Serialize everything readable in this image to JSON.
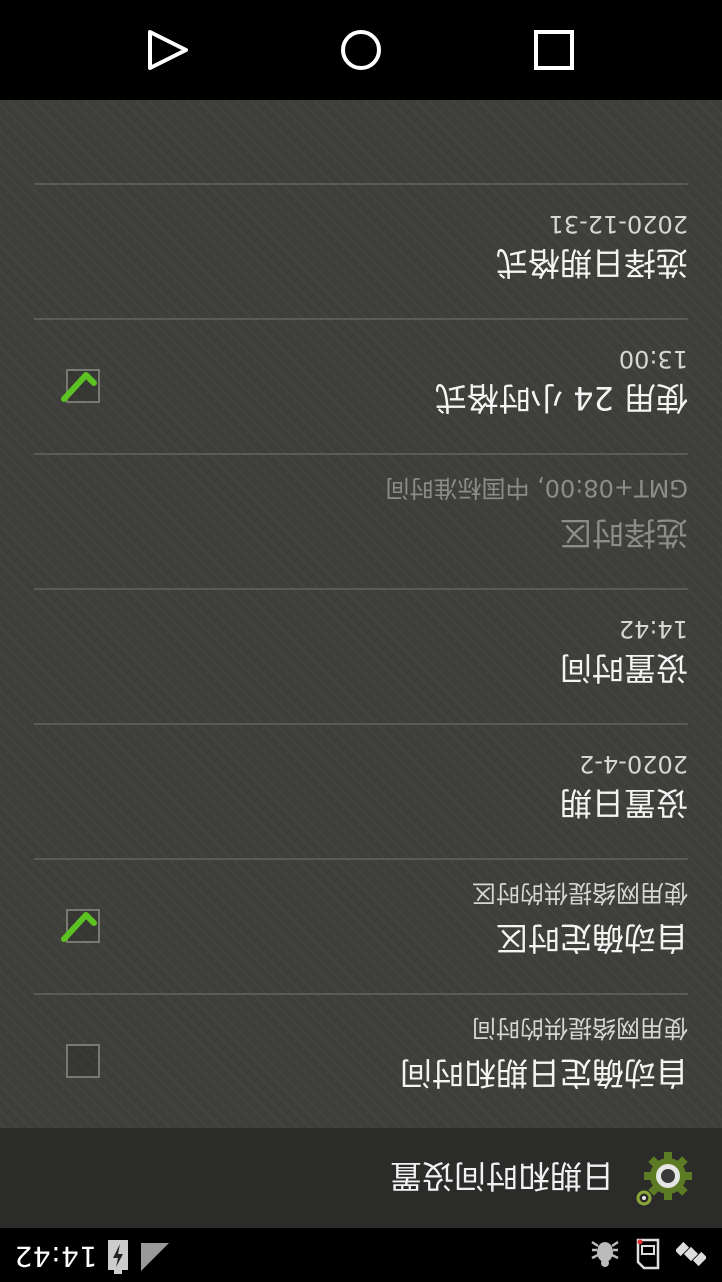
{
  "status_bar": {
    "time": "14:42",
    "icons": [
      "satellite-icon",
      "sd-card-icon",
      "debug-bug-icon",
      "signal-icon",
      "battery-charging-icon"
    ]
  },
  "action_bar": {
    "title": "日期和时间设置",
    "icon": "settings-gear-icon"
  },
  "settings": {
    "items": [
      {
        "title": "自动确定日期和时间",
        "summary": "使用网络提供的时间",
        "checkbox": true,
        "checked": false,
        "enabled": true
      },
      {
        "title": "自动确定时区",
        "summary": "使用网络提供的时区",
        "checkbox": true,
        "checked": true,
        "enabled": true
      },
      {
        "title": "设置日期",
        "summary": "2020-4-2",
        "checkbox": false,
        "enabled": true
      },
      {
        "title": "设置时间",
        "summary": "14:42",
        "checkbox": false,
        "enabled": true
      },
      {
        "title": "选择时区",
        "summary": "GMT+08:00, 中国标准时间",
        "checkbox": false,
        "enabled": false
      },
      {
        "title": "使用 24 小时格式",
        "summary": "13:00",
        "checkbox": true,
        "checked": true,
        "enabled": true
      },
      {
        "title": "选择日期格式",
        "summary": "2020-12-31",
        "checkbox": false,
        "enabled": true
      }
    ]
  },
  "nav_bar": {
    "buttons": [
      "back-icon",
      "home-icon",
      "recents-icon"
    ]
  },
  "colors": {
    "check_green": "#5cc221",
    "list_background": "#3e3f3a",
    "divider": "#5a5b56",
    "disabled_text": "#8c8c88"
  },
  "orientation": "rotated-180"
}
